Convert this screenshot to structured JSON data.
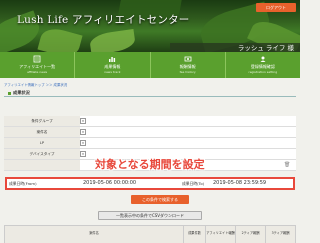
{
  "header": {
    "title": "Lush Life アフィリエイトセンター",
    "logout_label": "ログアウト",
    "user_name": "ラッシュ ライフ 様"
  },
  "nav": [
    {
      "label": "アフィリエイト一覧",
      "sub": "affiliate news",
      "icon": "list-icon"
    },
    {
      "label": "成果情報",
      "sub": "news track",
      "icon": "chart-icon"
    },
    {
      "label": "報酬情報",
      "sub": "fee history",
      "icon": "money-icon"
    },
    {
      "label": "登録情報確認",
      "sub": "registration setting",
      "icon": "profile-icon"
    }
  ],
  "breadcrumb": "アフィリエイト情報トップ ＞＞ 成果状況",
  "page_title": "成果状況",
  "filters": [
    {
      "label": "条件グループ"
    },
    {
      "label": "案件名"
    },
    {
      "label": "LP"
    },
    {
      "label": "デバイスタイプ"
    },
    {
      "label": ""
    }
  ],
  "callout": "対象となる期間を設定",
  "period": {
    "from_label": "成果日時(From)",
    "from_value": "2019-05-06 00:00:00",
    "to_label": "成果日時(To)",
    "to_value": "2019-05-08 23:59:59"
  },
  "search_button": "この条件で検索する",
  "csv_button": "一覧表示中の条件でCSVダウンロード",
  "table_headers": [
    "案件名",
    "成果件数",
    "アフィリエイト報酬",
    "2ティア報酬",
    "3ティア報酬"
  ],
  "colors": {
    "accent": "#e8612c",
    "nav": "#5aa02e",
    "callout": "#e8483b"
  }
}
